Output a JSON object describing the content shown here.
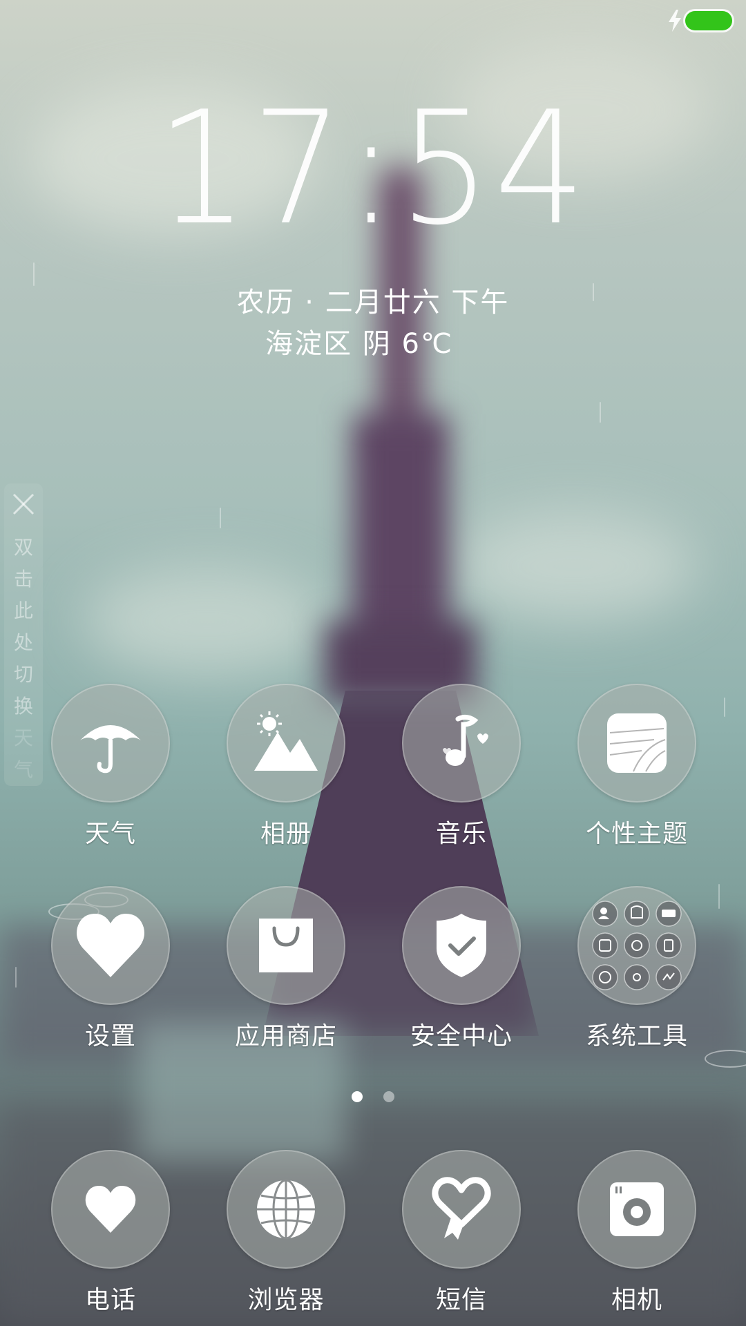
{
  "status_bar": {
    "charging_icon": "lightning-icon",
    "battery_color": "#33c41a"
  },
  "lockscreen": {
    "time": "17:54",
    "lunar_date": "农历 · 二月廿六  下午",
    "weather": "海淀区  阴  6℃"
  },
  "switch_strip": {
    "close_icon": "close-icon",
    "text": [
      "双",
      "击",
      "此",
      "处",
      "切",
      "换",
      "天",
      "气"
    ]
  },
  "apps": [
    {
      "label": "天气",
      "icon": "umbrella-icon"
    },
    {
      "label": "相册",
      "icon": "mountain-sun-icon"
    },
    {
      "label": "音乐",
      "icon": "music-note-icon"
    },
    {
      "label": "个性主题",
      "icon": "theme-card-icon"
    },
    {
      "label": "设置",
      "icon": "heart-icon"
    },
    {
      "label": "应用商店",
      "icon": "shopping-bag-icon"
    },
    {
      "label": "安全中心",
      "icon": "shield-check-icon"
    },
    {
      "label": "系统工具",
      "icon": "tools-folder-icon"
    }
  ],
  "pager": {
    "current_page": 1,
    "total_pages": 2
  },
  "dock": [
    {
      "label": "电话",
      "icon": "heart-phone-icon"
    },
    {
      "label": "浏览器",
      "icon": "globe-icon"
    },
    {
      "label": "短信",
      "icon": "ribbon-heart-icon"
    },
    {
      "label": "相机",
      "icon": "camera-icon"
    }
  ]
}
